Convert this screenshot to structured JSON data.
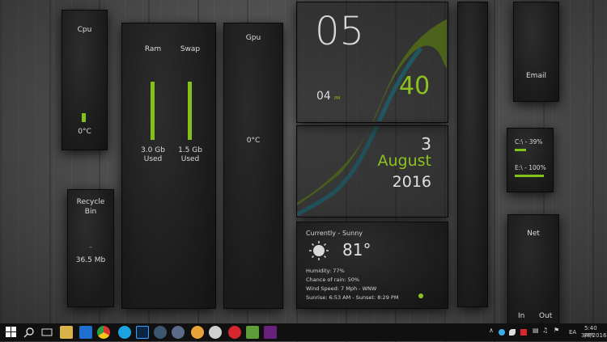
{
  "cpu": {
    "title": "Cpu",
    "temp": "0°C",
    "level": 0.12
  },
  "ram": {
    "title": "Ram",
    "value": "3.0 Gb",
    "sub": "Used",
    "level": 0.95
  },
  "swap": {
    "title": "Swap",
    "value": "1.5 Gb",
    "sub": "Used",
    "level": 0.95
  },
  "gpu": {
    "title": "Gpu",
    "temp": "0°C"
  },
  "recycle": {
    "title": "Recycle Bin",
    "dash": "-",
    "size": "36.5 Mb"
  },
  "clock": {
    "hour": "05",
    "minute": "04",
    "ampm": "PM",
    "seconds": "40"
  },
  "date": {
    "day": "3",
    "month": "August",
    "year": "2016"
  },
  "weather": {
    "current": "Currently - Sunny",
    "temp": "81°",
    "humidity": "Humidity: 77%",
    "rain": "Chance of rain: 50%",
    "wind": "Wind Speed: 7 Mph - WNW",
    "sun": "Sunrise: 6:53 AM - Sunset: 8:29 PM"
  },
  "email": {
    "label": "Email"
  },
  "drives": {
    "c": "C:\\ - 39%",
    "c_level": 0.39,
    "e": "E:\\ - 100%",
    "e_level": 1.0
  },
  "net": {
    "title": "Net",
    "in": "In",
    "out": "Out"
  },
  "taskbar": {
    "time": "5:40 pm",
    "date": "3/8/2016",
    "lang": "EA",
    "icons": [
      "start-icon",
      "search-icon",
      "task-view-icon",
      "file-explorer-icon",
      "store-icon",
      "chrome-icon",
      "skype-icon",
      "photoshop-icon",
      "steam-icon",
      "firefox-icon",
      "browser-icon",
      "mega-icon",
      "app-icon",
      "vs-icon"
    ]
  },
  "colors": {
    "accent": "#8cc21f",
    "teal": "#2aa3b8",
    "panel": "#1c1c1c"
  }
}
